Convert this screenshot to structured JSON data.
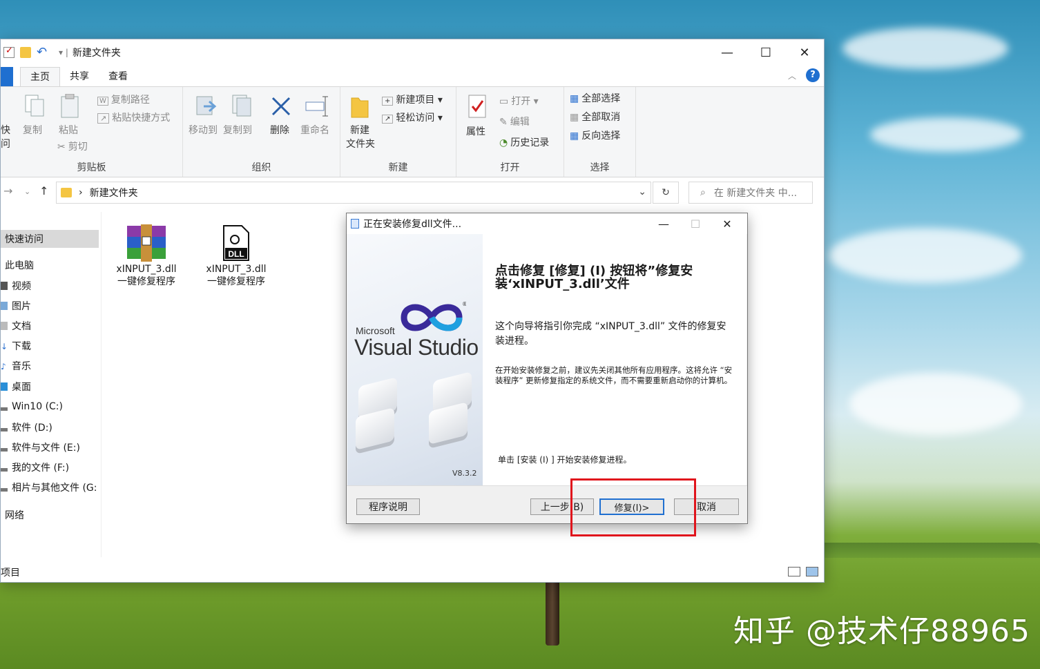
{
  "explorer": {
    "title": "新建文件夹",
    "tabs": [
      "主页",
      "共享",
      "查看"
    ],
    "ribbon": {
      "clipboard": {
        "label": "剪贴板",
        "pin": "快",
        "pin2": "问",
        "copy": "复制",
        "paste": "粘贴",
        "copy_path": "复制路径",
        "paste_shortcut": "粘贴快捷方式",
        "cut": "剪切"
      },
      "organize": {
        "label": "组织",
        "move_to": "移动到",
        "copy_to": "复制到",
        "delete": "删除",
        "rename": "重命名"
      },
      "new": {
        "label": "新建",
        "new_folder_1": "新建",
        "new_folder_2": "文件夹",
        "new_item": "新建项目",
        "easy_access": "轻松访问"
      },
      "open": {
        "label": "打开",
        "properties": "属性",
        "open": "打开",
        "edit": "编辑",
        "history": "历史记录"
      },
      "select": {
        "label": "选择",
        "select_all": "全部选择",
        "select_none": "全部取消",
        "invert": "反向选择"
      }
    },
    "address": {
      "crumb": "新建文件夹",
      "search_placeholder": "在 新建文件夹 中..."
    },
    "sidebar": [
      "快速访问",
      "此电脑",
      "视频",
      "图片",
      "文档",
      "下载",
      "音乐",
      "桌面",
      "Win10 (C:)",
      "软件 (D:)",
      "软件与文件 (E:)",
      "我的文件 (F:)",
      "相片与其他文件 (G:",
      "网络"
    ],
    "files": [
      {
        "name1": "xINPUT_3.dll",
        "name2": "一键修复程序",
        "icon": "winrar-archive-icon"
      },
      {
        "name1": "xINPUT_3.dll",
        "name2": "一键修复程序",
        "icon": "dll-file-icon"
      }
    ],
    "status": "项目"
  },
  "dialog": {
    "title": "正在安装修复dll文件...",
    "ms": "Microsoft",
    "vs": "Visual Studio",
    "version": "V8.3.2",
    "heading": "点击修复 [修复] (I) 按钮将”修复安装‘xINPUT_3.dll’文件",
    "p1": "这个向导将指引你完成 “xINPUT_3.dll” 文件的修复安装进程。",
    "p2": "在开始安装修复之前，建议先关闭其他所有应用程序。这将允许 “安装程序” 更新修复指定的系统文件，而不需要重新启动你的计算机。",
    "p3": "单击 [安装 (I) ] 开始安装修复进程。",
    "buttons": {
      "about": "程序说明",
      "back": "上一步(B)",
      "repair": "修复(I)>",
      "cancel": "取消"
    }
  },
  "watermark": "知乎 @技术仔88965",
  "colors": {
    "accent": "#1f6fd0",
    "highlight": "#e0141c"
  }
}
